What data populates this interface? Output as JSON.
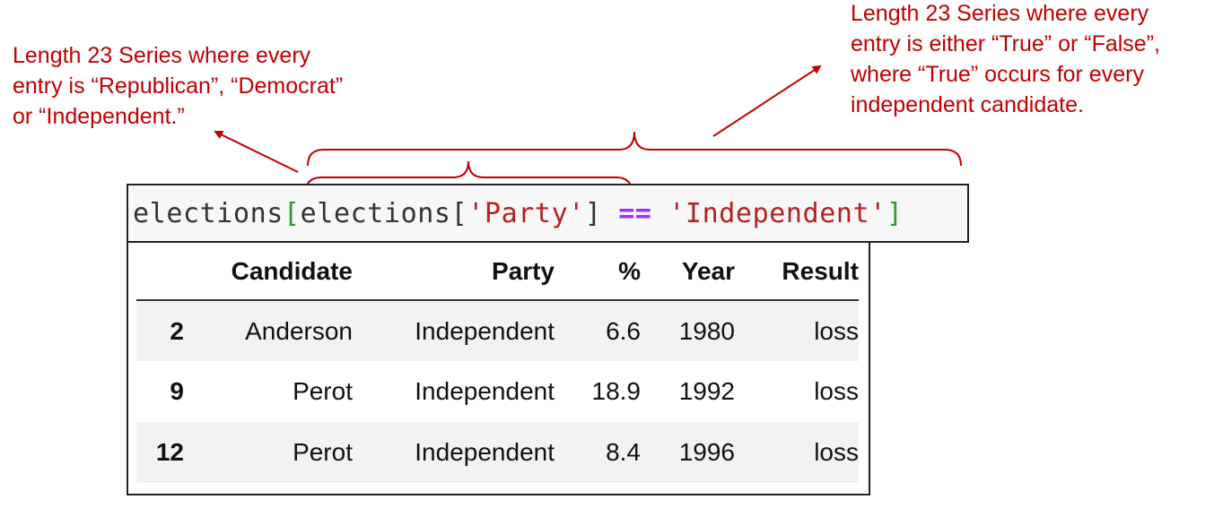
{
  "annotations": {
    "left": "Length 23 Series where every\nentry is “Republican”, “Democrat”\nor “Independent.”",
    "right": "Length 23 Series where every\nentry is either “True” or “False”,\nwhere “True” occurs for every\nindependent candidate."
  },
  "code": {
    "tokens": {
      "name1": "elections",
      "open_outer": "[",
      "name2": "elections",
      "open_inner": "[",
      "key": "'Party'",
      "close_inner": "]",
      "op": "==",
      "value": "'Independent'",
      "close_outer": "]"
    }
  },
  "table": {
    "columns": [
      "",
      "Candidate",
      "Party",
      "%",
      "Year",
      "Result"
    ],
    "rows": [
      {
        "index": "2",
        "cells": [
          "Anderson",
          "Independent",
          "6.6",
          "1980",
          "loss"
        ]
      },
      {
        "index": "9",
        "cells": [
          "Perot",
          "Independent",
          "18.9",
          "1992",
          "loss"
        ]
      },
      {
        "index": "12",
        "cells": [
          "Perot",
          "Independent",
          "8.4",
          "1996",
          "loss"
        ]
      }
    ]
  },
  "colors": {
    "annotation": "#c00000",
    "bracket": "#2e9a2e",
    "string": "#b22222",
    "operator": "#9b30ff"
  }
}
